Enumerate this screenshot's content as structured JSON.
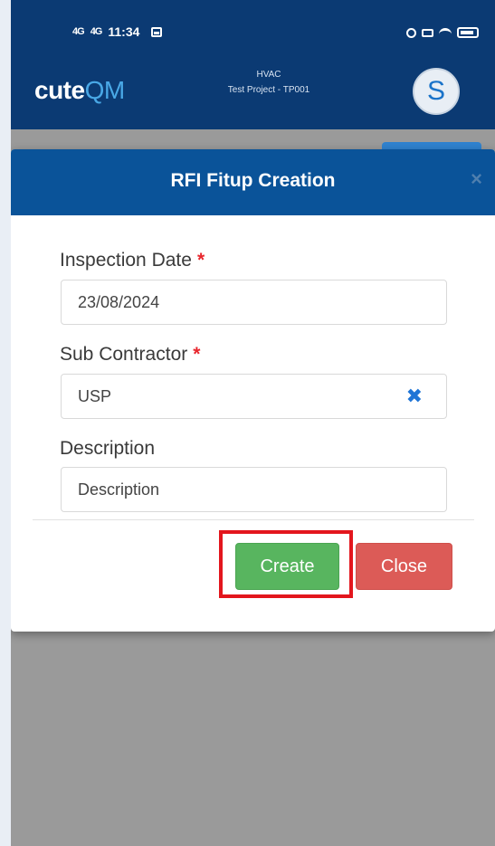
{
  "status_bar": {
    "signal1": "4G",
    "signal2": "4G",
    "time": "11:34"
  },
  "header": {
    "logo_part1": "cute",
    "logo_part2": "QM",
    "project_line1": "HVAC",
    "project_line2": "Test Project - TP001",
    "avatar_initial": "S"
  },
  "modal": {
    "title": "RFI Fitup Creation",
    "close_icon": "×",
    "fields": [
      {
        "label": "Inspection Date",
        "required_mark": "*",
        "value": "23/08/2024"
      },
      {
        "label": "Sub Contractor",
        "required_mark": "*",
        "value": "USP",
        "clear_icon": "✖"
      },
      {
        "label": "Description",
        "placeholder": "Description"
      }
    ],
    "buttons": {
      "create": "Create",
      "close": "Close"
    }
  },
  "colors": {
    "header_bg": "#0b3a73",
    "modal_header_bg": "#0a5399",
    "create_button": "#58b55f",
    "close_button": "#dc5b57",
    "highlight": "#e3161d",
    "required": "#e8262d"
  }
}
